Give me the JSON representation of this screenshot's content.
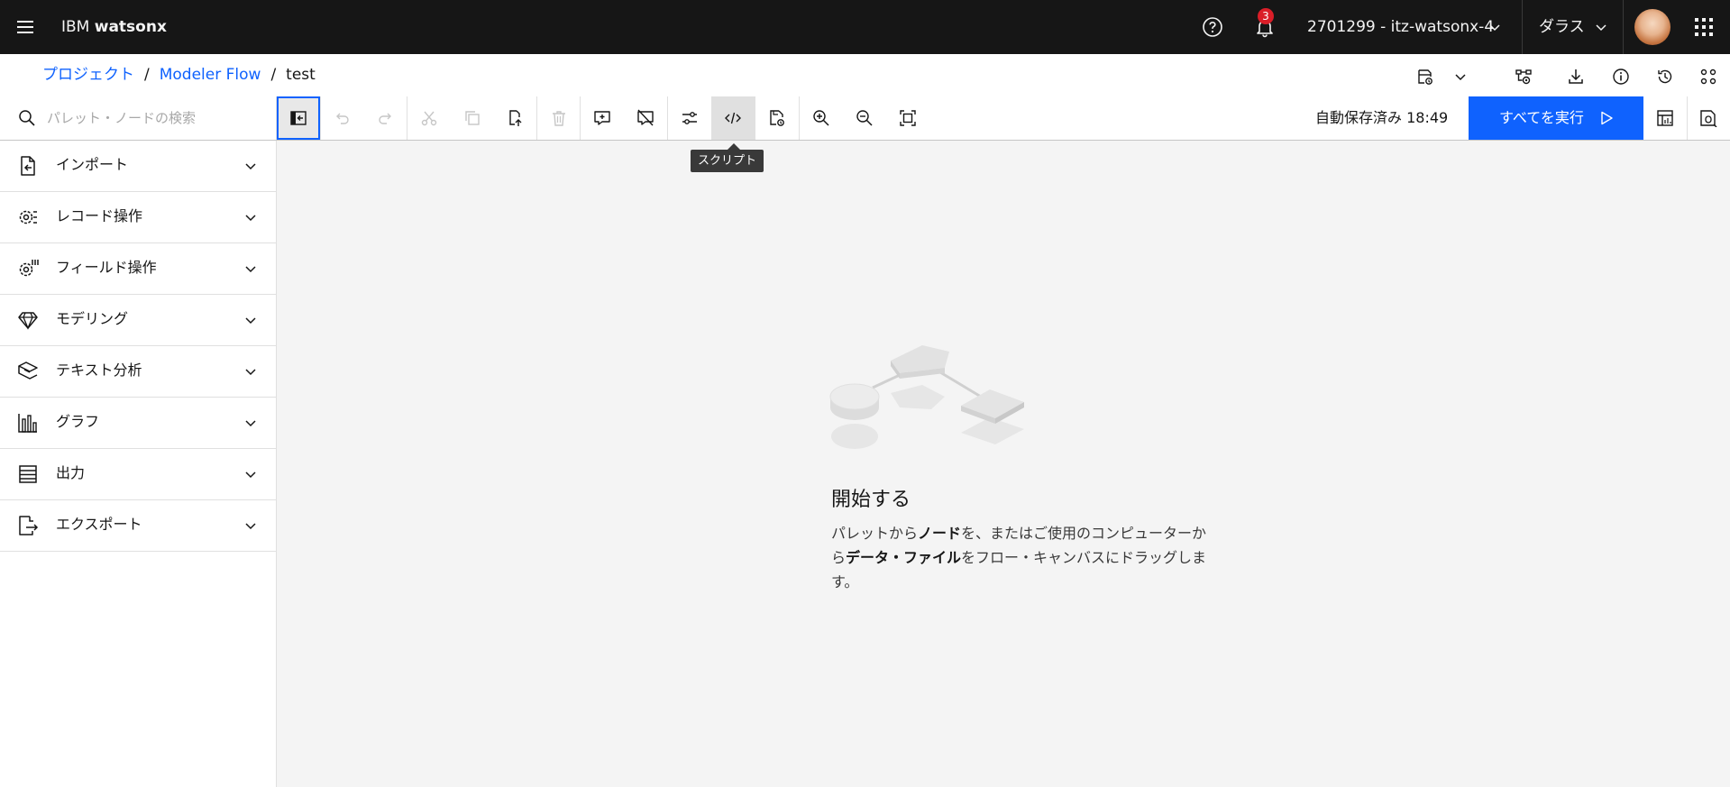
{
  "header": {
    "brand_prefix": "IBM",
    "brand_name": "watsonx",
    "notifications_count": "3",
    "account": "2701299 - itz-watsonx-4",
    "region": "ダラス"
  },
  "breadcrumb": {
    "items": [
      "プロジェクト",
      "Modeler Flow",
      "test"
    ],
    "separator": "/"
  },
  "toolbar": {
    "search_placeholder": "パレット・ノードの検索",
    "autosave": "自動保存済み 18:49",
    "run_all": "すべてを実行",
    "tooltip": "スクリプト"
  },
  "palette": {
    "items": [
      "インポート",
      "レコード操作",
      "フィールド操作",
      "モデリング",
      "テキスト分析",
      "グラフ",
      "出力",
      "エクスポート"
    ]
  },
  "empty_state": {
    "title": "開始する",
    "desc_1": "パレットから",
    "desc_2": "ノード",
    "desc_3": "を、またはご使用のコンピューターから",
    "desc_4": "データ・ファイル",
    "desc_5": "をフロー・キャンバスにドラッグします。"
  },
  "colors": {
    "accent": "#0f62fe",
    "header_bg": "#161616",
    "notification_badge": "#da1e28",
    "canvas_bg": "#f4f4f4"
  }
}
